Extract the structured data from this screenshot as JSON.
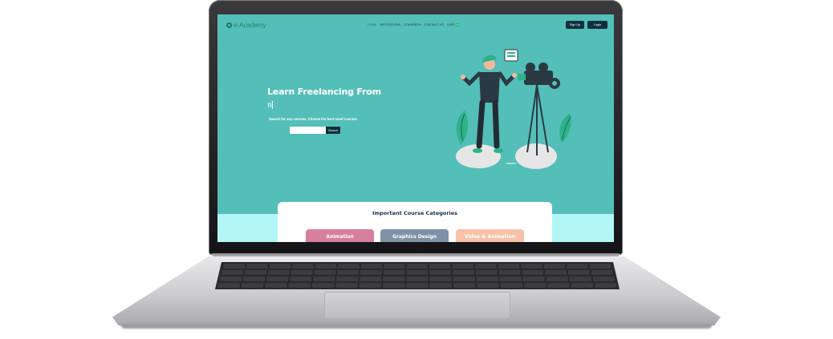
{
  "logo": {
    "text": "e-Academy"
  },
  "nav": {
    "items": [
      {
        "label": "HOME",
        "active": true
      },
      {
        "label": "INSTITUTIONS",
        "active": false
      },
      {
        "label": "COURSES ▾",
        "active": false
      },
      {
        "label": "CONTACT US",
        "active": false
      },
      {
        "label": "CART",
        "active": false
      }
    ],
    "cart_count": "0",
    "signup_label": "Sign Up",
    "login_label": "Login"
  },
  "hero": {
    "title": "Learn Freelancing From",
    "typed_text": "n",
    "subtitle": "Search for any courses, Choose the best rated courses",
    "search_placeholder": "",
    "search_button": "Search"
  },
  "categories": {
    "title": "Important Course Categories",
    "items": [
      {
        "label": "Animation",
        "color": "#d97f9e"
      },
      {
        "label": "Graphics Design",
        "color": "#7e92a6"
      },
      {
        "label": "Video & Animation",
        "color": "#f7c2a9"
      }
    ]
  },
  "colors": {
    "hero_bg": "#54beb9",
    "band_bg": "#b2f6f6",
    "dark": "#11303f",
    "brand": "#1c8760"
  }
}
